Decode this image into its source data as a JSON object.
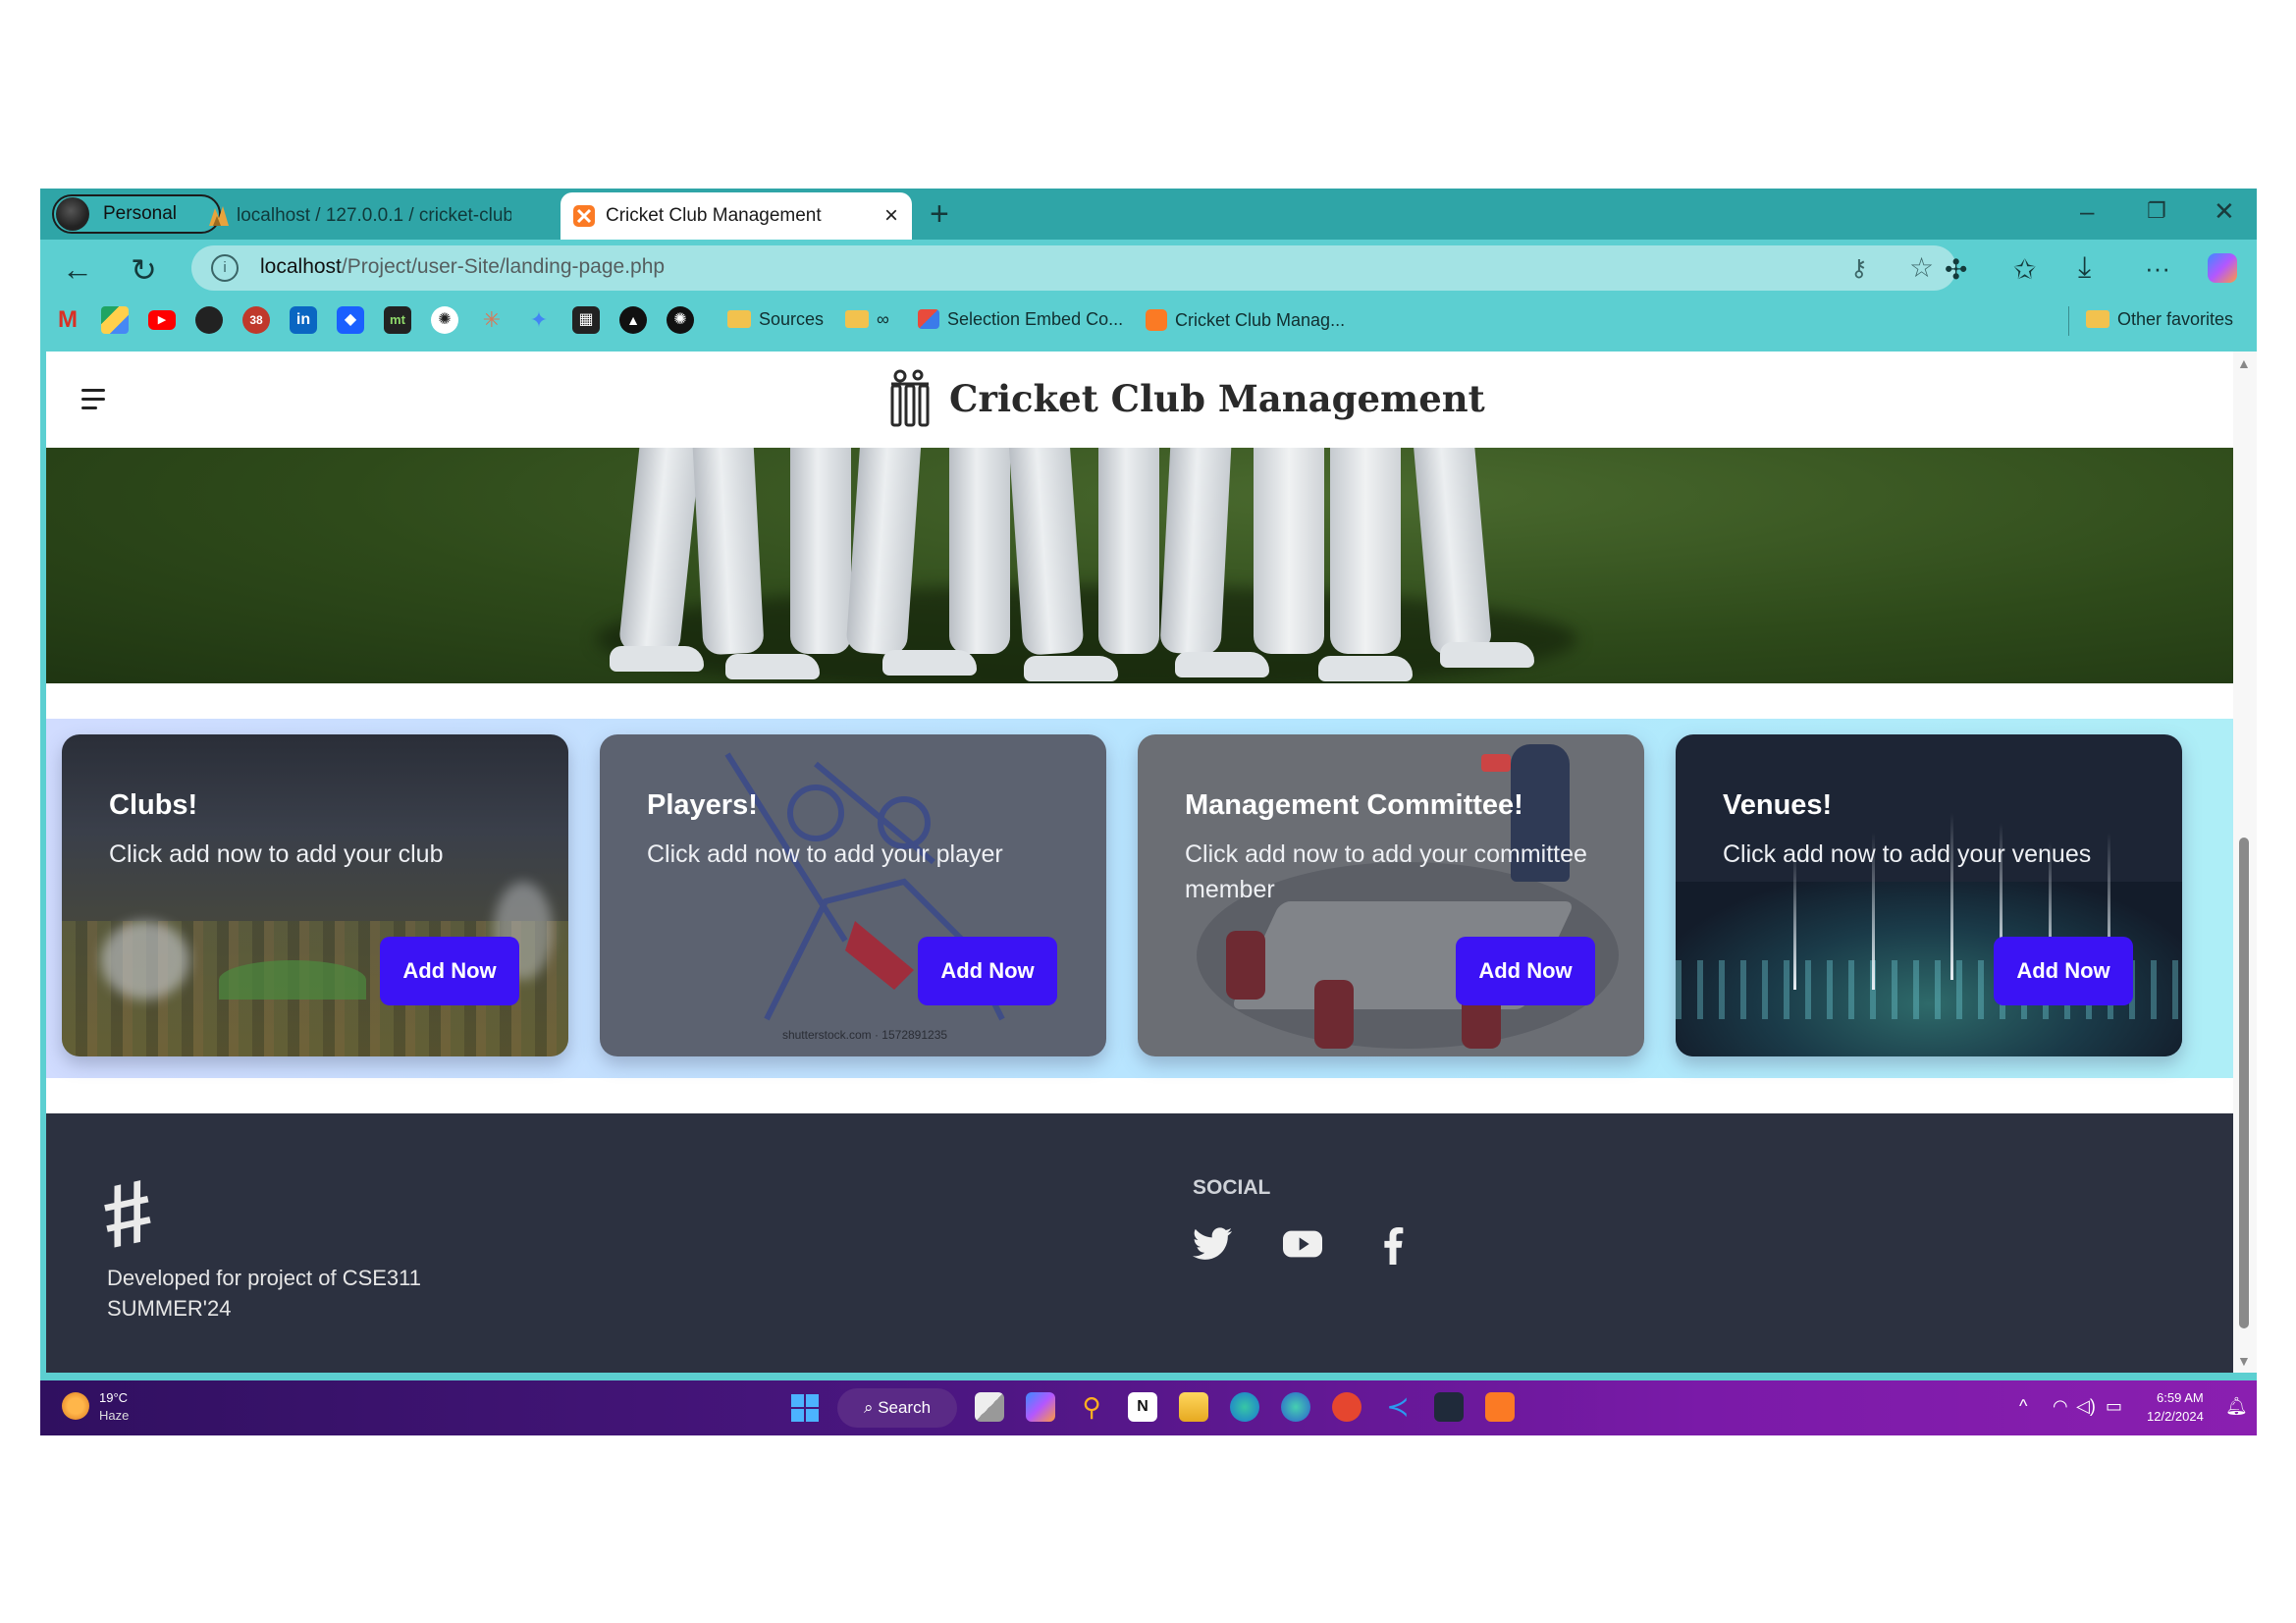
{
  "browser": {
    "profile_label": "Personal",
    "tabs": [
      {
        "title": "localhost / 127.0.0.1 / cricket-club"
      },
      {
        "title": "Cricket Club Management"
      }
    ],
    "url_host": "localhost",
    "url_path": "/Project/user-Site/landing-page.php",
    "bookmarks": {
      "sources": "Sources",
      "infinity": "∞",
      "selection_embed": "Selection Embed Co...",
      "cricket_club": "Cricket Club Manag...",
      "other_favorites": "Other favorites"
    }
  },
  "site": {
    "title": "Cricket Club Management",
    "cards": [
      {
        "title": "Clubs!",
        "text": "Click add now to add your club",
        "button": "Add Now",
        "color": "#2b2f3a"
      },
      {
        "title": "Players!",
        "text": "Click add now to add your player",
        "button": "Add Now",
        "color": "#5c6270",
        "watermark": "shutterstock.com · 1572891235"
      },
      {
        "title": "Management Committee!",
        "text": "Click add now to add your committee member",
        "button": "Add Now",
        "color": "#6b6e74"
      },
      {
        "title": "Venues!",
        "text": "Click add now to add your venues",
        "button": "Add Now",
        "color": "#1d2535"
      }
    ],
    "footer": {
      "logo_glyph": "#",
      "text": "Developed for project of CSE311 SUMMER'24",
      "social_title": "SOCIAL",
      "social_icons": [
        "twitter-icon",
        "youtube-icon",
        "facebook-icon"
      ]
    }
  },
  "taskbar": {
    "temperature": "19°C",
    "condition": "Haze",
    "search_label": "Search",
    "time": "6:59 AM",
    "date": "12/2/2024"
  },
  "colors": {
    "browser_chrome": "#5ccfd1",
    "tab_strip": "#2fa5a7",
    "button": "#3b12f5",
    "footer": "#2c3140"
  }
}
